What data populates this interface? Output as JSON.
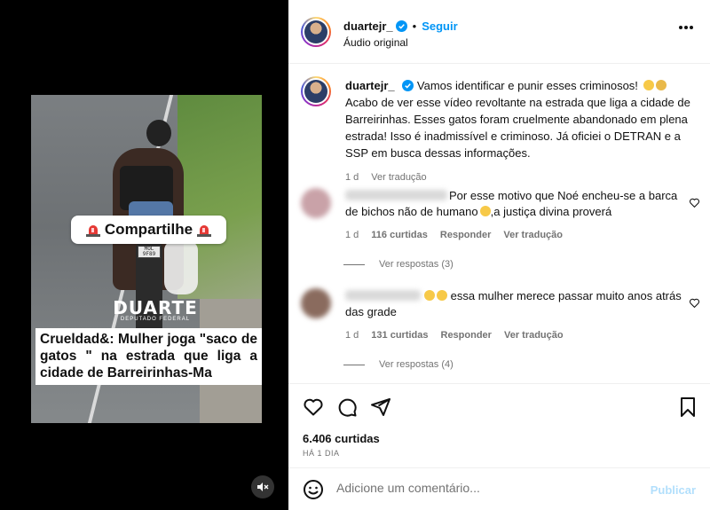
{
  "video": {
    "share_label": "Compartilhe",
    "plate_text": "MOL 9F89",
    "brand_name": "DUARTE",
    "brand_sub": "DEPUTADO FEDERAL",
    "caption": "Crueldad&: Mulher joga \"saco de gatos \" na estrada que liga a cidade de Barreirinhas-Ma"
  },
  "header": {
    "username": "duartejr_",
    "separator": "•",
    "follow_label": "Seguir",
    "audio_label": "Áudio original"
  },
  "caption": {
    "username": "duartejr_",
    "text": "Vamos identificar e punir esses criminosos! ",
    "text_rest": "Acabo de ver esse vídeo revoltante na estrada que liga a cidade de Barreirinhas. Esses gatos foram cruelmente abandonado em plena estrada! Isso é inadmissível e criminoso. Já oficiei o DETRAN e a SSP em busca dessas informações.",
    "age": "1 d",
    "translate_label": "Ver tradução"
  },
  "comments": [
    {
      "text": "Por esse motivo que Noé encheu-se a barca de bichos não de humano",
      "text_after_emoji": ",a justiça divina proverá",
      "age": "1 d",
      "likes": "116 curtidas",
      "reply_label": "Responder",
      "translate_label": "Ver tradução",
      "view_replies": "Ver respostas (3)"
    },
    {
      "text": "essa mulher merece passar muito anos atrás das grade",
      "age": "1 d",
      "likes": "131 curtidas",
      "reply_label": "Responder",
      "translate_label": "Ver tradução",
      "view_replies": "Ver respostas (4)"
    }
  ],
  "actions": {
    "likes": "6.406 curtidas",
    "time": "HÁ 1 DIA"
  },
  "add_comment": {
    "placeholder": "Adicione um comentário...",
    "publish_label": "Publicar"
  },
  "colors": {
    "accent": "#0095f6",
    "muted_text": "#737373",
    "publish_disabled": "#b2dffc"
  }
}
